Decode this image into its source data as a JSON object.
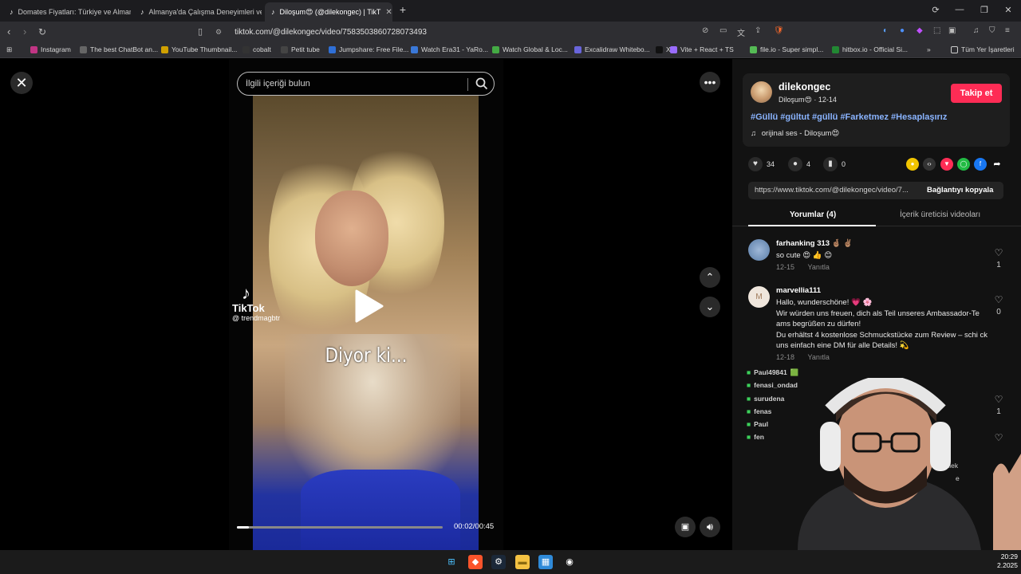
{
  "browser": {
    "tabs": [
      {
        "title": "Domates Fiyatları: Türkiye ve Almany"
      },
      {
        "title": "Almanya'da Çalışma Deneyimleri ve Ç"
      },
      {
        "title": "Diloşum😍 (@dilekongec) | TikT"
      }
    ],
    "new_tab": "+",
    "url": "tiktok.com/@dilekongec/video/7583503860728073493",
    "bookmarks": [
      {
        "label": "Instagram",
        "icon": "instagram-icon",
        "color": "#c13584"
      },
      {
        "label": "The best ChatBot an...",
        "icon": "chatbot-icon",
        "color": "#666666"
      },
      {
        "label": "YouTube Thumbnail...",
        "icon": "youtube-icon",
        "color": "#d0a000"
      },
      {
        "label": "cobalt",
        "icon": "cobalt-icon",
        "color": "#333333"
      },
      {
        "label": "Petit tube",
        "icon": "petit-tube-icon",
        "color": "#444444"
      },
      {
        "label": "Jumpshare: Free File...",
        "icon": "jumpshare-icon",
        "color": "#2f6fd6"
      },
      {
        "label": "Watch Era31 - YaRo...",
        "icon": "era31-icon",
        "color": "#3a78d8"
      },
      {
        "label": "Watch Global & Loc...",
        "icon": "watch-icon",
        "color": "#44aa44"
      },
      {
        "label": "Excalidraw Whitebo...",
        "icon": "excalidraw-icon",
        "color": "#6965db"
      },
      {
        "label": "X",
        "icon": "x-icon",
        "color": "#111111"
      },
      {
        "label": "Vite + React + TS",
        "icon": "vite-icon",
        "color": "#9a6cff"
      },
      {
        "label": "file.io - Super simpl...",
        "icon": "fileio-icon",
        "color": "#55bb55"
      },
      {
        "label": "hitbox.io - Official Si...",
        "icon": "hitbox-icon",
        "color": "#228833"
      }
    ],
    "more_bookmarks": "»",
    "all_bookmarks": "Tüm Yer İşaretleri"
  },
  "video": {
    "search_placeholder": "İlgili içeriği bulun",
    "caption": "Diyor ki...",
    "watermark_name": "TikTok",
    "watermark_handle": "@ trendmagbtr",
    "time": "00:02/00:45",
    "progress": 0.06
  },
  "creator": {
    "username": "dilekongec",
    "display_name": "Diloşum😍",
    "date": "12-14",
    "follow_label": "Takip et",
    "hashtags": "#Güllü #gültut #güllü #Farketmez #Hesaplaşırız",
    "music": "orijinal ses - Diloşum😍"
  },
  "actions": {
    "likes": "34",
    "comments": "4",
    "saves": "0",
    "link": "https://www.tiktok.com/@dilekongec/video/7...",
    "copy_label": "Bağlantıyı kopyala"
  },
  "tabs": {
    "comments": "Yorumlar (4)",
    "creator_videos": "İçerik üreticisi videoları"
  },
  "comments": [
    {
      "user": "farhanking 313 🤞🏽 ✌🏽",
      "text": "so cute 😍 👍 😊",
      "date": "12-15",
      "reply": "Yanıtla",
      "likes": "1"
    },
    {
      "user": "marvellia111",
      "text": "Hallo, wunderschöne! 💗 🌸\nWir würden uns freuen, dich als Teil unseres Ambassador-Te ams begrüßen zu dürfen!\nDu erhältst 4 kostenlose Schmuckstücke zum Review – schi ck uns einfach eine DM für alle Details! 💫",
      "date": "12-18",
      "reply": "Yanıtla",
      "likes": "0"
    },
    {
      "likes": "1"
    }
  ],
  "stream_chat": [
    {
      "user": "Paul49841",
      "text": "🟩"
    },
    {
      "user": "fenasi_ondad",
      "text": ""
    },
    {
      "user": "surudena",
      "text": ""
    },
    {
      "user": "fenas",
      "text": ""
    },
    {
      "user": "Paul",
      "text": ""
    },
    {
      "user": "fen",
      "text": ""
    },
    {
      "user": "",
      "text": "sonra dilek"
    },
    {
      "user": "",
      "text": "e"
    }
  ],
  "taskbar": {
    "time": "20:29",
    "date": "2.2025"
  }
}
